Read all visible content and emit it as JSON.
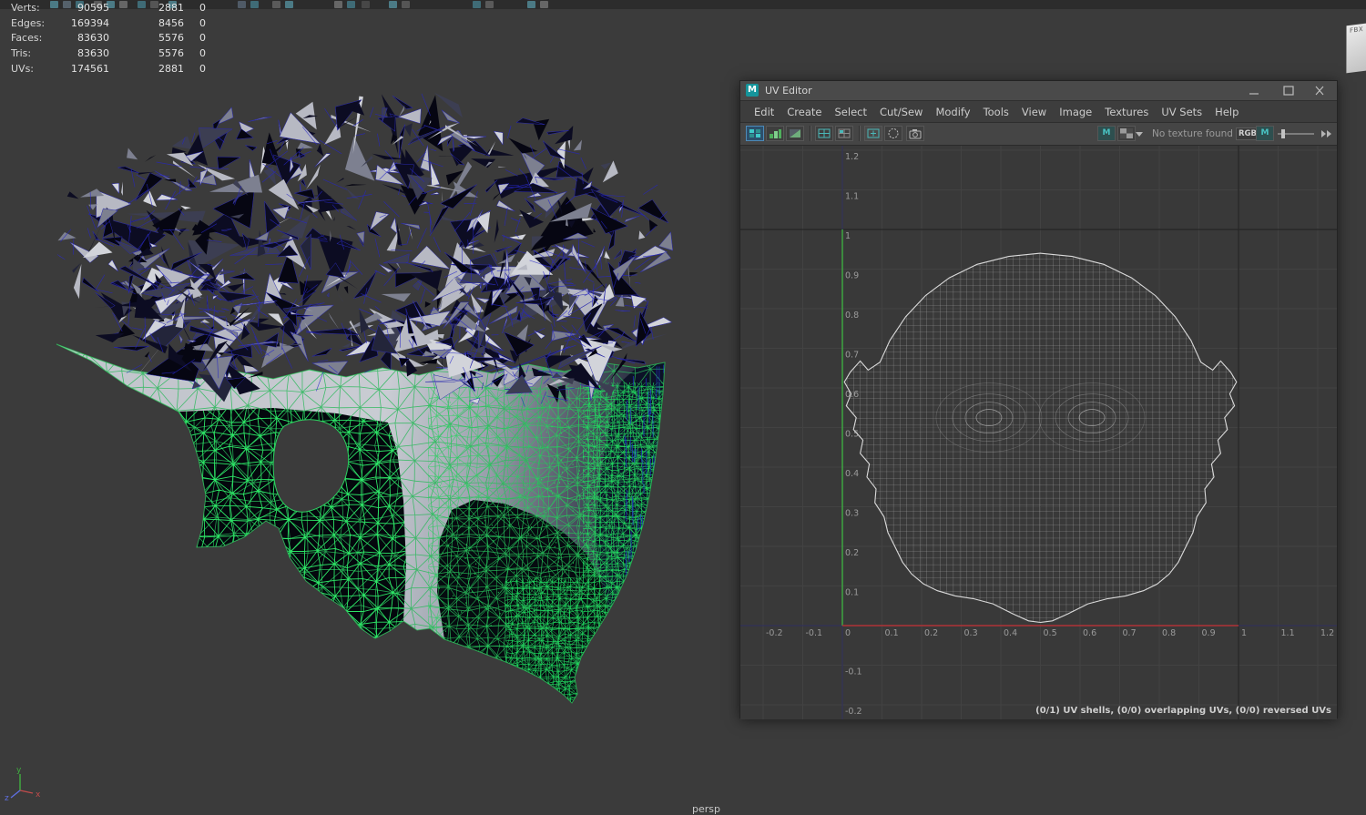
{
  "hud": {
    "rows": [
      {
        "label": "Verts:",
        "total": "90595",
        "selected": "2881",
        "extra": "0"
      },
      {
        "label": "Edges:",
        "total": "169394",
        "selected": "8456",
        "extra": "0"
      },
      {
        "label": "Faces:",
        "total": "83630",
        "selected": "5576",
        "extra": "0"
      },
      {
        "label": "Tris:",
        "total": "83630",
        "selected": "5576",
        "extra": "0"
      },
      {
        "label": "UVs:",
        "total": "174561",
        "selected": "2881",
        "extra": "0"
      }
    ]
  },
  "viewport": {
    "camera_label": "persp",
    "axis_labels": {
      "x": "x",
      "y": "y",
      "z": "z"
    }
  },
  "corner_tab": {
    "label": "FBX"
  },
  "uv_editor": {
    "title": "UV Editor",
    "icon_letter": "M",
    "menus": [
      "Edit",
      "Create",
      "Select",
      "Cut/Sew",
      "Modify",
      "Tools",
      "View",
      "Image",
      "Textures",
      "UV Sets",
      "Help"
    ],
    "toolbar": {
      "no_texture": "No texture found",
      "rgb": "RGB"
    },
    "tick_values": [
      "-0.2",
      "-0.1",
      "0",
      "0.1",
      "0.2",
      "0.3",
      "0.4",
      "0.5",
      "0.6",
      "0.7",
      "0.8",
      "0.9",
      "1",
      "1.1",
      "1.2"
    ],
    "status": "(0/1) UV shells, (0/0) overlapping UVs, (0/0) reversed UVs"
  },
  "colors": {
    "selection_green": "#2bd05e",
    "bright_green": "#2ef06a",
    "wire_blue": "#2a2ac0",
    "maya_teal": "#15959b",
    "axis_red": "#b03434",
    "axis_green": "#3fae3f",
    "axis_blue": "#33335a"
  }
}
